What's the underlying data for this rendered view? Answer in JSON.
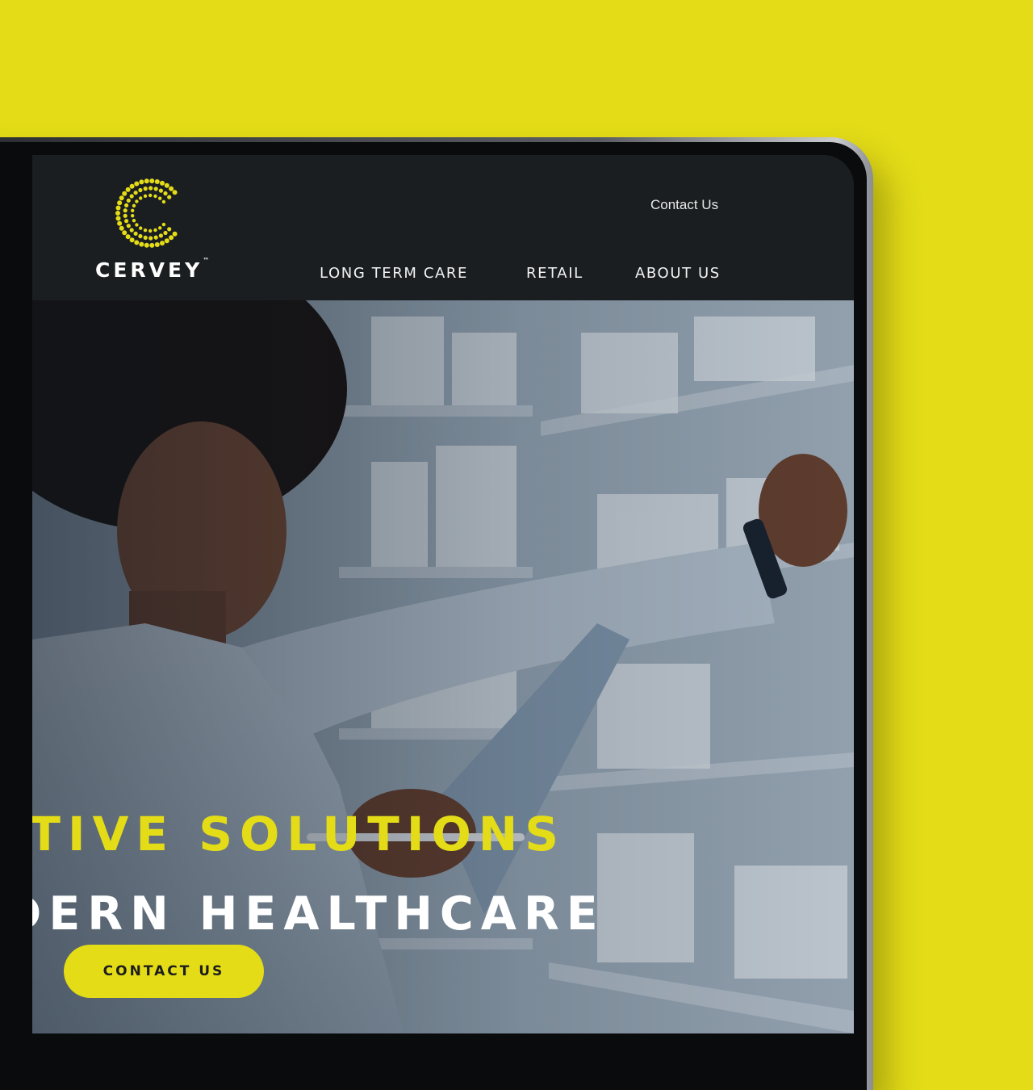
{
  "brand": {
    "name": "CERVEY",
    "trademark": "™"
  },
  "header": {
    "contact_link": "Contact Us",
    "nav": [
      "LONG TERM CARE",
      "RETAIL",
      "ABOUT US"
    ]
  },
  "hero": {
    "title_line1": "ATIVE SOLUTIONS",
    "title_line2": "DERN HEALTHCARE",
    "cta_label": "CONTACT US"
  },
  "colors": {
    "accent": "#e3dc17",
    "page_background": "#e3dc17",
    "header_background": "#1b1e21",
    "text_light": "#ffffff"
  },
  "icons": {
    "logo": "cervey-dotted-c-logo-icon"
  }
}
